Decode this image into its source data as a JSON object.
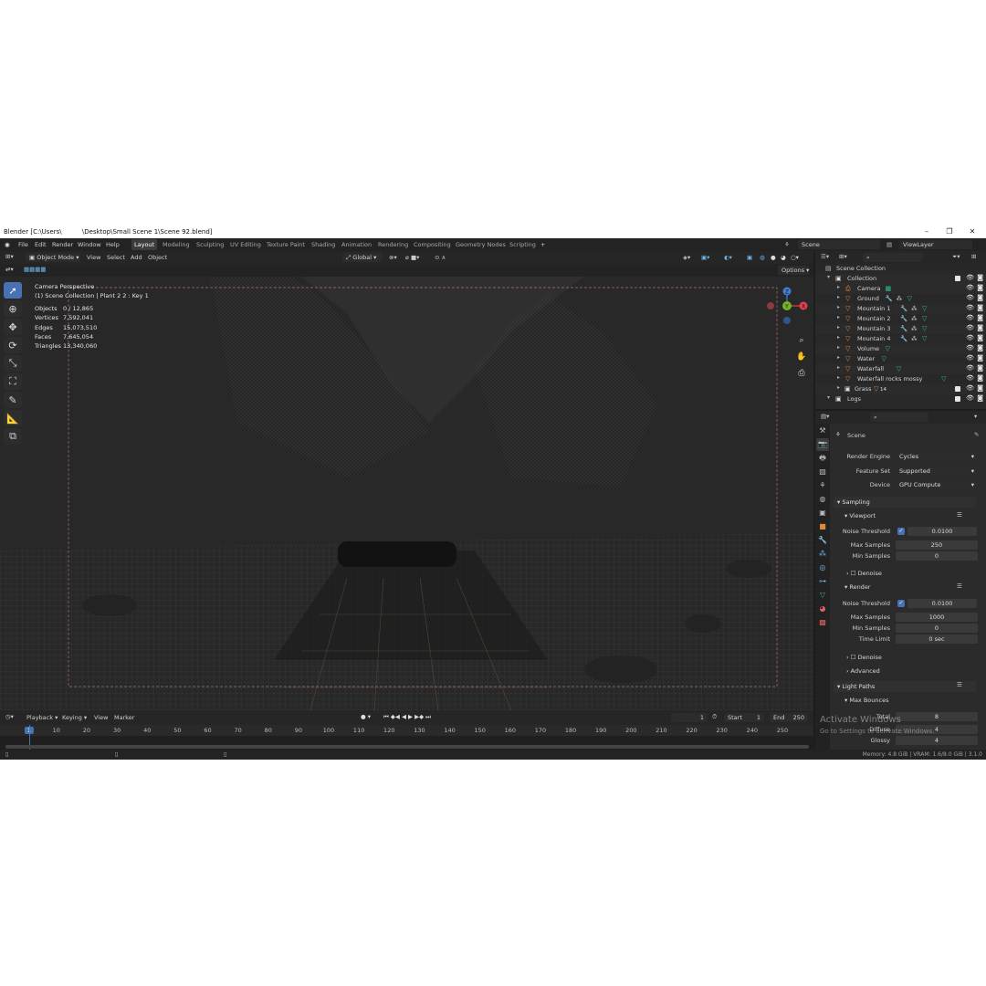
{
  "window": {
    "title": "Blender [C:\\Users\\          \\Desktop\\Small Scene 1\\Scene 92.blend]"
  },
  "menu": [
    "File",
    "Edit",
    "Render",
    "Window",
    "Help"
  ],
  "workspaces": [
    "Layout",
    "Modeling",
    "Sculpting",
    "UV Editing",
    "Texture Paint",
    "Shading",
    "Animation",
    "Rendering",
    "Compositing",
    "Geometry Nodes",
    "Scripting"
  ],
  "workspace_add": "+",
  "scene_field": "Scene",
  "viewlayer_field": "ViewLayer",
  "viewport": {
    "mode": "Object Mode",
    "menus": [
      "View",
      "Select",
      "Add",
      "Object"
    ],
    "transform": "Global",
    "options": "Options",
    "camera_label": "Camera Perspective",
    "collection_label": "(1) Scene Collection | Plant 2 2 : Key 1",
    "stats": [
      {
        "label": "Objects",
        "value": "0 / 12,865"
      },
      {
        "label": "Vertices",
        "value": "7,592,041"
      },
      {
        "label": "Edges",
        "value": "15,073,510"
      },
      {
        "label": "Faces",
        "value": "7,645,054"
      },
      {
        "label": "Triangles",
        "value": "13,340,060"
      }
    ],
    "gizmo": {
      "z": "Z",
      "y": "Y",
      "x": "X"
    }
  },
  "timeline": {
    "menus": [
      "Playback",
      "Keying",
      "View",
      "Marker"
    ],
    "current_frame": "1",
    "start_label": "Start",
    "start": "1",
    "end_label": "End",
    "end": "250",
    "ticks": [
      "1",
      "10",
      "20",
      "30",
      "40",
      "50",
      "60",
      "70",
      "80",
      "90",
      "100",
      "110",
      "120",
      "130",
      "140",
      "150",
      "160",
      "170",
      "180",
      "190",
      "200",
      "210",
      "220",
      "230",
      "240",
      "250"
    ]
  },
  "outliner": {
    "root": "Scene Collection",
    "collection": "Collection",
    "items": [
      {
        "name": "Camera"
      },
      {
        "name": "Ground"
      },
      {
        "name": "Mountain 1"
      },
      {
        "name": "Mountain 2"
      },
      {
        "name": "Mountain 3"
      },
      {
        "name": "Mountain 4"
      },
      {
        "name": "Volume"
      },
      {
        "name": "Water"
      },
      {
        "name": "Waterfall"
      },
      {
        "name": "Waterfall rocks mossy"
      }
    ],
    "grass": "Grass",
    "grass_badge": "14",
    "logs": "Logs"
  },
  "properties": {
    "context": "Scene",
    "render_engine_label": "Render Engine",
    "render_engine": "Cycles",
    "feature_set_label": "Feature Set",
    "feature_set": "Supported",
    "device_label": "Device",
    "device": "GPU Compute",
    "sampling": "Sampling",
    "viewport_sub": "Viewport",
    "noise_threshold_label": "Noise Threshold",
    "viewport_noise_threshold": "0.0100",
    "max_samples_label": "Max Samples",
    "viewport_max_samples": "250",
    "min_samples_label": "Min Samples",
    "viewport_min_samples": "0",
    "denoise": "Denoise",
    "render_sub": "Render",
    "render_noise_threshold": "0.0100",
    "render_max_samples": "1000",
    "render_min_samples": "0",
    "time_limit_label": "Time Limit",
    "time_limit": "0 sec",
    "advanced": "Advanced",
    "light_paths": "Light Paths",
    "max_bounces": "Max Bounces",
    "total_label": "Total",
    "total": "8",
    "diffuse_label": "Diffuse",
    "diffuse": "4",
    "glossy_label": "Glossy",
    "glossy": "4"
  },
  "watermark": {
    "line1": "Activate Windows",
    "line2": "Go to Settings to activate Windows."
  },
  "status": {
    "memory": "Memory: 4.8 GiB | VRAM: 1.6/8.0 GiB | 3.1.0"
  },
  "colors": {
    "accent": "#4772b3",
    "x_axis": "#e0414d",
    "y_axis": "#73b229",
    "z_axis": "#3f7fd6"
  }
}
